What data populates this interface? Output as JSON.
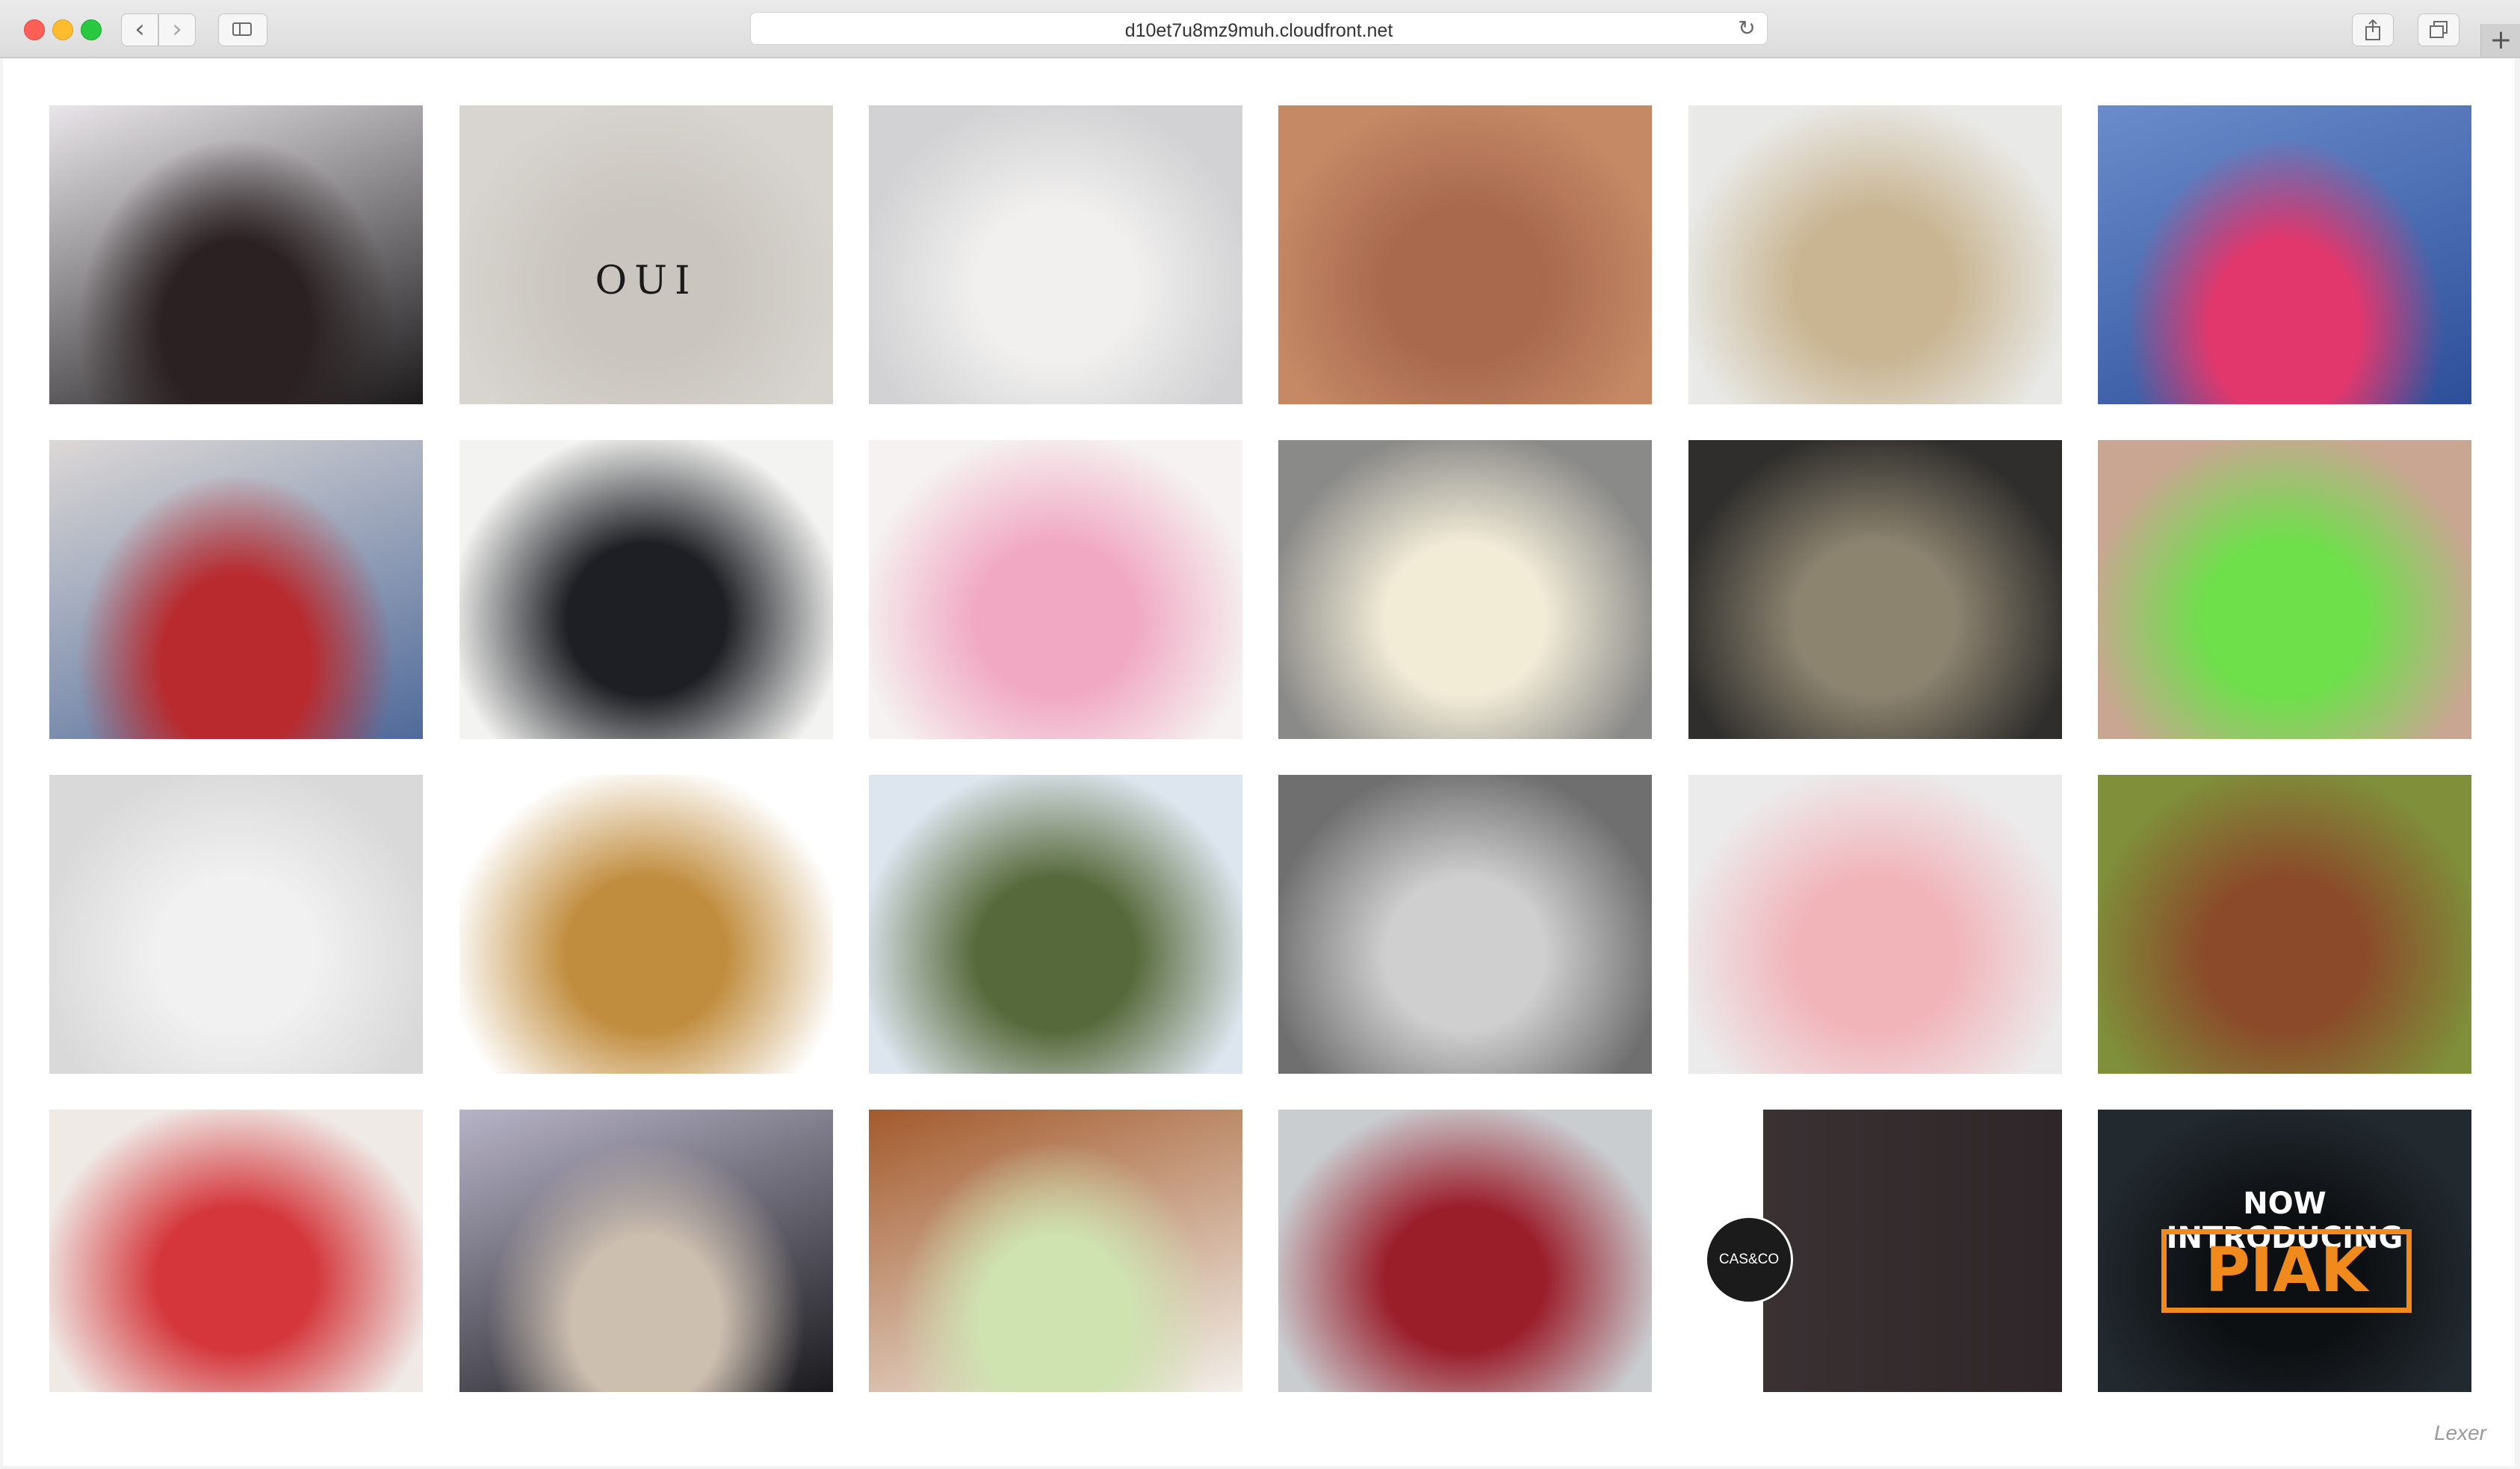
{
  "browser": {
    "url": "d10et7u8mz9muh.cloudfront.net",
    "back_icon": "‹",
    "forward_icon": "›",
    "reload_icon": "↻",
    "plus_icon": "+"
  },
  "gallery": {
    "tiles": [
      {
        "name": "model-band-tee",
        "colors": [
          "#e9e6ea",
          "#2b2122",
          "#1c1a1b"
        ]
      },
      {
        "name": "oui-card",
        "colors": [
          "#d8d4cf",
          "#cac5bf"
        ],
        "caption": "OUI"
      },
      {
        "name": "model-white-sweatshirt",
        "colors": [
          "#d2d1d3",
          "#f1f0ef"
        ]
      },
      {
        "name": "gold-necklace",
        "colors": [
          "#c58966",
          "#a8694d"
        ]
      },
      {
        "name": "blonde-hair",
        "colors": [
          "#e9eae8",
          "#c9b592"
        ]
      },
      {
        "name": "candy-display",
        "colors": [
          "#6a8ccb",
          "#e2376c",
          "#2d4f9a"
        ]
      },
      {
        "name": "red-crop-top",
        "colors": [
          "#dcd8d6",
          "#b82a2e",
          "#4f6a9a"
        ]
      },
      {
        "name": "black-ankle-boot",
        "colors": [
          "#f3f3f1",
          "#1d1f24"
        ]
      },
      {
        "name": "girl-toy-makeup",
        "colors": [
          "#f5f2f1",
          "#f1a8c3"
        ]
      },
      {
        "name": "candle",
        "colors": [
          "#8a8a88",
          "#f2ecd7"
        ]
      },
      {
        "name": "fish-net",
        "colors": [
          "#2f2e2c",
          "#8d8470"
        ]
      },
      {
        "name": "neon-sandals",
        "colors": [
          "#c9a692",
          "#6de04a"
        ]
      },
      {
        "name": "white-maxi-dress",
        "colors": [
          "#d9d9da",
          "#f1f1f2"
        ]
      },
      {
        "name": "rvca-hoodie",
        "colors": [
          "#ffffff",
          "#c08c3d"
        ]
      },
      {
        "name": "green-sweatshirt",
        "colors": [
          "#dde6ef",
          "#56693a"
        ]
      },
      {
        "name": "glassware-bw",
        "colors": [
          "#6f6f6f",
          "#cfcfcf"
        ]
      },
      {
        "name": "baby-pink-overalls",
        "colors": [
          "#ecebec",
          "#f1b4b9"
        ]
      },
      {
        "name": "brown-dog",
        "colors": [
          "#7f8f3a",
          "#8b4a2a"
        ]
      },
      {
        "name": "red-sweatshirt-selfie",
        "colors": [
          "#efeae6",
          "#d4363b"
        ]
      },
      {
        "name": "surfer-beach",
        "colors": [
          "#b7b3c7",
          "#cdbfb0",
          "#1a1a1e"
        ]
      },
      {
        "name": "spray-bottles",
        "colors": [
          "#a35a2c",
          "#cfe3b1",
          "#f2efe9"
        ]
      },
      {
        "name": "red-velvet-dress",
        "colors": [
          "#c9cdd0",
          "#9a1d2a"
        ]
      },
      {
        "name": "cas-and-co-model",
        "colors": [
          "#ffffff",
          "#2e2628"
        ],
        "badge": "CAS&CO"
      },
      {
        "name": "piak-ad",
        "colors": [
          "#22292f",
          "#0d1013"
        ],
        "headline": "NOW INTRODUCING",
        "brand": "PIAK"
      }
    ]
  },
  "footer": {
    "watermark": "Lexer"
  }
}
